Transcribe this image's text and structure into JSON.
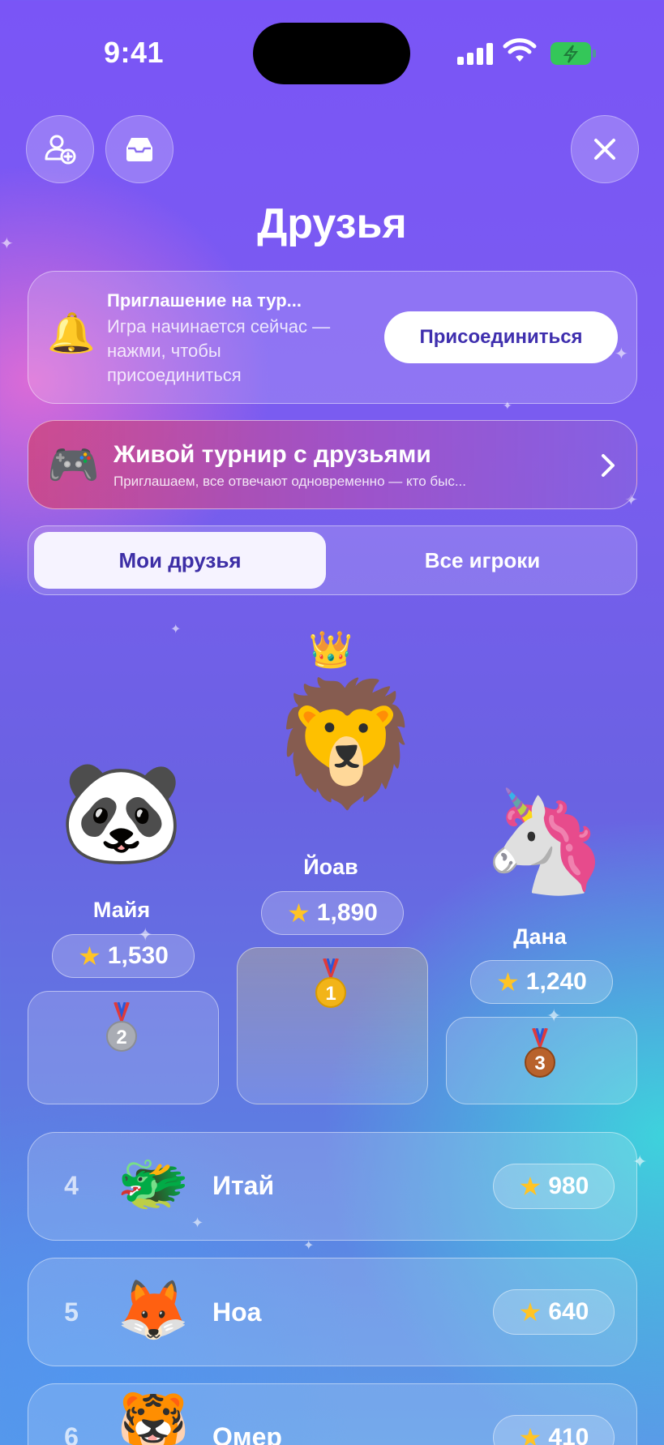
{
  "status": {
    "time": "9:41"
  },
  "header": {
    "add_friend_icon": "person-plus-icon",
    "inbox_icon": "inbox-icon",
    "close_icon": "close-icon",
    "title": "Друзья"
  },
  "invite": {
    "icon": "bell-icon",
    "title": "Приглашение на тур...",
    "subtitle": "Игра начинается сейчас — нажми, чтобы присоединиться",
    "button": "Присоединиться"
  },
  "tournament": {
    "icon": "gamepad-icon",
    "title": "Живой турнир с друзьями",
    "subtitle": "Приглашаем, все отвечают одновременно — кто быс..."
  },
  "tabs": {
    "active": "Мои друзья",
    "inactive": "Все игроки"
  },
  "podium": {
    "first": {
      "name": "Йоав",
      "score": "1,890",
      "medal": "1",
      "avatar": "lion",
      "crown": "crown-icon"
    },
    "second": {
      "name": "Майя",
      "score": "1,530",
      "medal": "2",
      "avatar": "panda-chef"
    },
    "third": {
      "name": "Дана",
      "score": "1,240",
      "medal": "3",
      "avatar": "unicorn"
    }
  },
  "list": [
    {
      "rank": "4",
      "name": "Итай",
      "score": "980",
      "avatar": "dragon"
    },
    {
      "rank": "5",
      "name": "Ноа",
      "score": "640",
      "avatar": "fox"
    },
    {
      "rank": "6",
      "name": "Омер",
      "score": "410",
      "avatar": "tiger"
    }
  ],
  "colors": {
    "accent": "#3d2ea6",
    "star": "#ffc425",
    "gold": "#f2b418",
    "silver": "#a9acb4",
    "bronze": "#b8622c",
    "battery": "#34c759"
  }
}
